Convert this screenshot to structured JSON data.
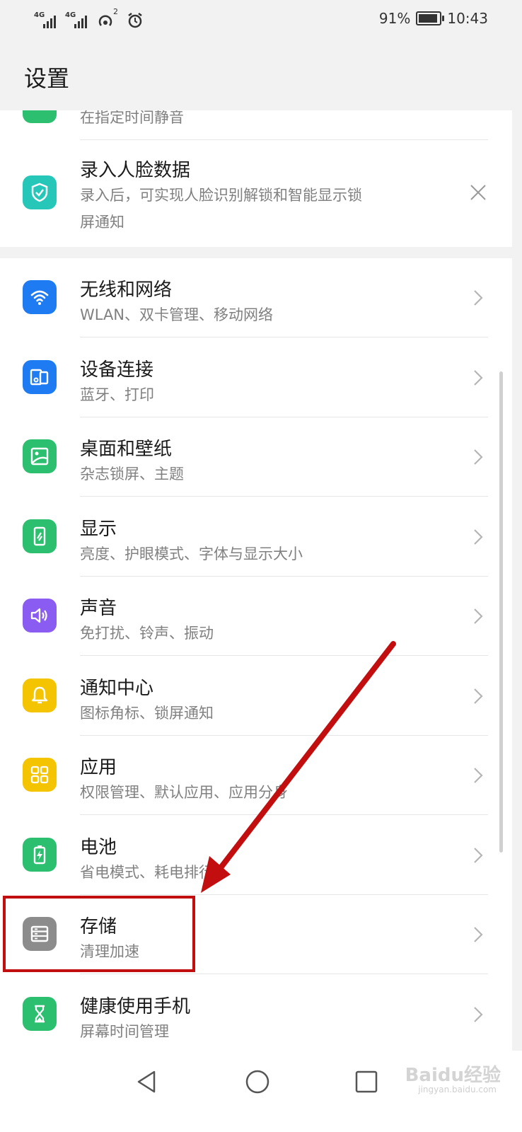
{
  "status_bar": {
    "sim1_label": "4G",
    "sim2_label": "4G",
    "hotspot_count": "2",
    "battery_percent": "91%",
    "battery_level": 0.91,
    "time": "10:43"
  },
  "header": {
    "title": "设置"
  },
  "suggestions": {
    "partial_item_subtitle": "在指定时间静音",
    "face_item": {
      "title": "录入人脸数据",
      "subtitle_line1": "录入后，可实现人脸识别解锁和智能显示锁",
      "subtitle_line2": "屏通知",
      "icon": "shield-check-icon",
      "color": "#26c6b8"
    }
  },
  "settings": {
    "items": [
      {
        "title": "无线和网络",
        "subtitle": "WLAN、双卡管理、移动网络",
        "icon": "wifi-icon",
        "color": "#1e7bf2"
      },
      {
        "title": "设备连接",
        "subtitle": "蓝牙、打印",
        "icon": "device-connect-icon",
        "color": "#1e7bf2"
      },
      {
        "title": "桌面和壁纸",
        "subtitle": "杂志锁屏、主题",
        "icon": "wallpaper-icon",
        "color": "#2dbf70"
      },
      {
        "title": "显示",
        "subtitle": "亮度、护眼模式、字体与显示大小",
        "icon": "display-icon",
        "color": "#2dbf70"
      },
      {
        "title": "声音",
        "subtitle": "免打扰、铃声、振动",
        "icon": "sound-icon",
        "color": "#8a5cf2"
      },
      {
        "title": "通知中心",
        "subtitle": "图标角标、锁屏通知",
        "icon": "bell-icon",
        "color": "#f5c400"
      },
      {
        "title": "应用",
        "subtitle": "权限管理、默认应用、应用分身",
        "icon": "apps-grid-icon",
        "color": "#f5c400"
      },
      {
        "title": "电池",
        "subtitle": "省电模式、耗电排行",
        "icon": "battery-icon",
        "color": "#2dbf70"
      },
      {
        "title": "存储",
        "subtitle": "清理加速",
        "icon": "storage-icon",
        "color": "#8c8c8c"
      },
      {
        "title": "健康使用手机",
        "subtitle": "屏幕时间管理",
        "icon": "hourglass-icon",
        "color": "#2dbf70"
      }
    ]
  },
  "annotation": {
    "color": "#c20e0e",
    "highlighted_item": "存储"
  },
  "watermark": {
    "text": "Baidu经验",
    "sub": "jingyan.baidu.com"
  }
}
